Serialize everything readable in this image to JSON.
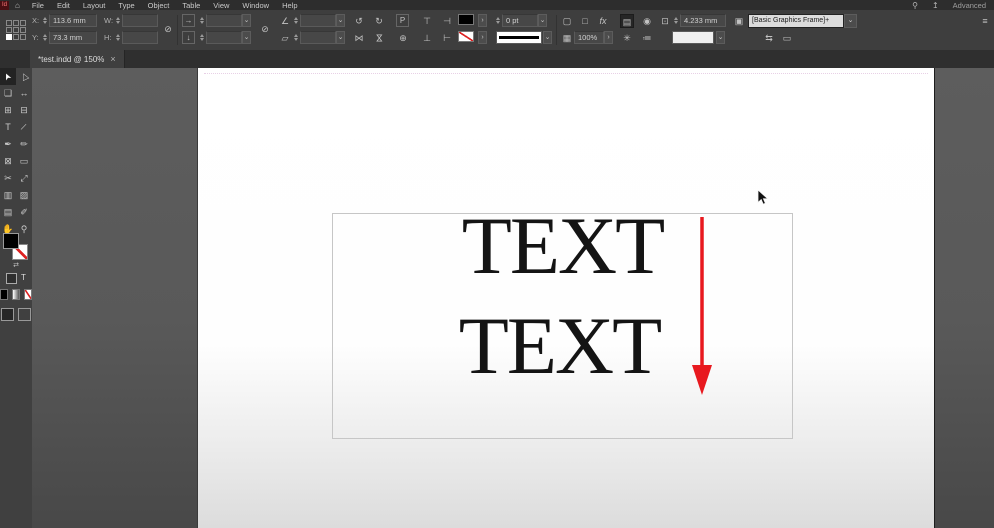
{
  "menubar": {
    "logo": "Id",
    "items": [
      "File",
      "Edit",
      "Layout",
      "Type",
      "Object",
      "Table",
      "View",
      "Window",
      "Help"
    ],
    "workspace": "Advanced",
    "home_glyph": "⌂",
    "ideas_glyph": "⚲",
    "share_glyph": "↥"
  },
  "tabbar": {
    "active_tab": "*test.indd @ 150%",
    "close_glyph": "×"
  },
  "control_panel": {
    "x_label": "X:",
    "x_value": "113.6 mm",
    "y_label": "Y:",
    "y_value": "73.3 mm",
    "w_label": "W:",
    "w_value": "",
    "h_label": "H:",
    "h_value": "",
    "scale_x_glyph": "→",
    "scale_y_glyph": "↓",
    "scale_x_value": "",
    "scale_y_value": "",
    "chain_glyph": "⊘",
    "link_glyph": "∞",
    "rotation_glyph": "∠",
    "rotation_value": "",
    "shear_glyph": "▱",
    "shear_value": "",
    "rotate_ccw_glyph": "↺",
    "rotate_cw_glyph": "↻",
    "flip_h_glyph": "⋈",
    "flip_v_glyph": "⋈",
    "select_container_glyph": "P",
    "select_content_glyph": "⊕",
    "align_top_glyph": "⊤",
    "align_mid_glyph": "⊣",
    "align_bottom_glyph": "⊥",
    "align_dist_glyph": "⊢",
    "chevron_right": "›",
    "chevron_down": "⌄",
    "stroke_weight": "0 pt",
    "corner_options_glyph": "▢",
    "corner_shape_glyph": "□",
    "fx_label": "fx",
    "opacity_glyph": "▦",
    "opacity_value": "100%",
    "wrap_none_glyph": "▤",
    "wrap_around_glyph": "◉",
    "wrap_opt1_glyph": "✳",
    "wrap_opt2_glyph": "≔",
    "frame_fit_glyph": "⊡",
    "gap_value": "4.233 mm",
    "style_mini_glyph": "▣",
    "object_style": "[Basic Graphics Frame]+",
    "quick_apply_glyph": "⇆",
    "break_link_glyph": "▭",
    "panel_menu_glyph": "≡"
  },
  "toolbar": {
    "tools": [
      {
        "name": "selection-tool",
        "icon": "selection-arrow-icon",
        "glyph": "➤",
        "active": true
      },
      {
        "name": "direct-selection-tool",
        "icon": "direct-selection-arrow-icon",
        "glyph": "▷",
        "active": false
      },
      {
        "name": "page-tool",
        "icon": "page-icon",
        "glyph": "❏",
        "active": false
      },
      {
        "name": "gap-tool",
        "icon": "gap-icon",
        "glyph": "↔",
        "active": false
      },
      {
        "name": "content-collector-tool",
        "icon": "content-collector-icon",
        "glyph": "⊞",
        "active": false
      },
      {
        "name": "content-placer-tool",
        "icon": "content-placer-icon",
        "glyph": "⊟",
        "active": false
      },
      {
        "name": "type-tool",
        "icon": "type-icon",
        "glyph": "T",
        "active": false
      },
      {
        "name": "line-tool",
        "icon": "line-icon",
        "glyph": "∕",
        "active": false
      },
      {
        "name": "pen-tool",
        "icon": "pen-icon",
        "glyph": "✒",
        "active": false
      },
      {
        "name": "pencil-tool",
        "icon": "pencil-icon",
        "glyph": "✏",
        "active": false
      },
      {
        "name": "rectangle-frame-tool",
        "icon": "rectangle-frame-icon",
        "glyph": "⊠",
        "active": false
      },
      {
        "name": "rectangle-tool",
        "icon": "rectangle-icon",
        "glyph": "▭",
        "active": false
      },
      {
        "name": "scissors-tool",
        "icon": "scissors-icon",
        "glyph": "✂",
        "active": false
      },
      {
        "name": "free-transform-tool",
        "icon": "free-transform-icon",
        "glyph": "⤢",
        "active": false
      },
      {
        "name": "gradient-swatch-tool",
        "icon": "gradient-swatch-icon",
        "glyph": "▥",
        "active": false
      },
      {
        "name": "gradient-feather-tool",
        "icon": "gradient-feather-icon",
        "glyph": "▨",
        "active": false
      },
      {
        "name": "note-tool",
        "icon": "note-icon",
        "glyph": "▤",
        "active": false
      },
      {
        "name": "eyedropper-tool",
        "icon": "eyedropper-icon",
        "glyph": "✐",
        "active": false
      },
      {
        "name": "hand-tool",
        "icon": "hand-icon",
        "glyph": "✋",
        "active": false
      },
      {
        "name": "zoom-tool",
        "icon": "zoom-icon",
        "glyph": "⚲",
        "active": false
      }
    ],
    "swap_glyph": "⇄",
    "formatting_text_glyph": "T"
  },
  "document": {
    "text_lines": [
      "TEXT",
      "TEXT"
    ],
    "annotation_arrow_color": "#e8191f"
  }
}
